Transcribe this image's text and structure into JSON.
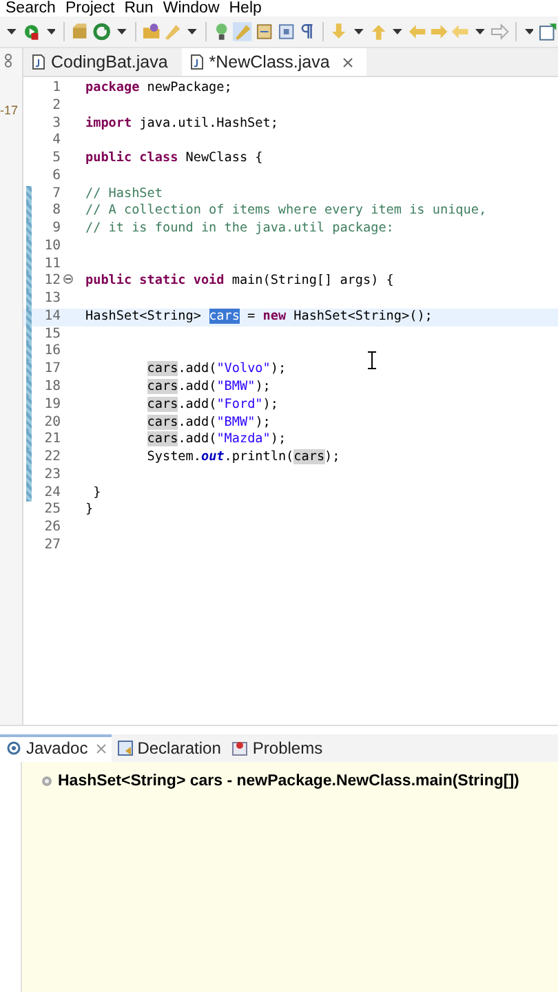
{
  "menu_bar": [
    "Search",
    "Project",
    "Run",
    "Window",
    "Help"
  ],
  "side_strip": {
    "text": "-17"
  },
  "editor_tabs": [
    {
      "label": "CodingBat.java",
      "selected": false,
      "closable": false
    },
    {
      "label": "*NewClass.java",
      "selected": true,
      "closable": true
    }
  ],
  "code_lines": [
    {
      "number": "1",
      "changed": false,
      "current": false,
      "tokens": [
        {
          "kind": "keyword",
          "text": "package"
        },
        {
          "kind": "text",
          "text": " newPackage;"
        }
      ]
    },
    {
      "number": "2",
      "changed": false,
      "current": false
    },
    {
      "number": "3",
      "changed": false,
      "current": false,
      "tokens": [
        {
          "kind": "keyword",
          "text": "import"
        },
        {
          "kind": "text",
          "text": " java.util.HashSet;"
        }
      ]
    },
    {
      "number": "4",
      "changed": false,
      "current": false
    },
    {
      "number": "5",
      "changed": false,
      "current": false,
      "tokens": [
        {
          "kind": "keyword",
          "text": "public class"
        },
        {
          "kind": "text",
          "text": " NewClass {"
        }
      ]
    },
    {
      "number": "6",
      "changed": false,
      "current": false
    },
    {
      "number": "7",
      "changed": true,
      "current": false,
      "tokens": [
        {
          "kind": "comment",
          "text": "// HashSet"
        }
      ]
    },
    {
      "number": "8",
      "changed": true,
      "current": false,
      "tokens": [
        {
          "kind": "comment",
          "text": "// A collection of items where every item is unique,"
        }
      ]
    },
    {
      "number": "9",
      "changed": true,
      "current": false,
      "tokens": [
        {
          "kind": "comment",
          "text": "// it is found in the java.util package:"
        }
      ]
    },
    {
      "number": "10",
      "changed": true,
      "current": false
    },
    {
      "number": "11",
      "changed": true,
      "current": false
    },
    {
      "number": "12",
      "changed": true,
      "current": false,
      "folded": false,
      "tokens": [
        {
          "kind": "keyword",
          "text": "public static void"
        },
        {
          "kind": "text",
          "text": " main(String[] args) {"
        }
      ]
    },
    {
      "number": "13",
      "changed": true,
      "current": false
    },
    {
      "number": "14",
      "changed": true,
      "current": true,
      "tokens": [
        {
          "kind": "text",
          "text": "HashSet<String> "
        },
        {
          "kind": "selected",
          "text": "cars"
        },
        {
          "kind": "text",
          "text": " = "
        },
        {
          "kind": "keyword",
          "text": "new"
        },
        {
          "kind": "text",
          "text": " HashSet<String>();"
        }
      ]
    },
    {
      "number": "15",
      "changed": true,
      "current": false
    },
    {
      "number": "16",
      "changed": true,
      "current": false
    },
    {
      "number": "17",
      "changed": true,
      "current": false,
      "indented": true,
      "tokens": [
        {
          "kind": "occurrence",
          "text": "cars"
        },
        {
          "kind": "text",
          "text": ".add("
        },
        {
          "kind": "string",
          "text": "\"Volvo\""
        },
        {
          "kind": "text",
          "text": ");"
        }
      ]
    },
    {
      "number": "18",
      "changed": true,
      "current": false,
      "indented": true,
      "tokens": [
        {
          "kind": "occurrence",
          "text": "cars"
        },
        {
          "kind": "text",
          "text": ".add("
        },
        {
          "kind": "string",
          "text": "\"BMW\""
        },
        {
          "kind": "text",
          "text": ");"
        }
      ]
    },
    {
      "number": "19",
      "changed": true,
      "current": false,
      "indented": true,
      "tokens": [
        {
          "kind": "occurrence",
          "text": "cars"
        },
        {
          "kind": "text",
          "text": ".add("
        },
        {
          "kind": "string",
          "text": "\"Ford\""
        },
        {
          "kind": "text",
          "text": ");"
        }
      ]
    },
    {
      "number": "20",
      "changed": true,
      "current": false,
      "indented": true,
      "tokens": [
        {
          "kind": "occurrence",
          "text": "cars"
        },
        {
          "kind": "text",
          "text": ".add("
        },
        {
          "kind": "string",
          "text": "\"BMW\""
        },
        {
          "kind": "text",
          "text": ");"
        }
      ]
    },
    {
      "number": "21",
      "changed": true,
      "current": false,
      "indented": true,
      "tokens": [
        {
          "kind": "occurrence",
          "text": "cars"
        },
        {
          "kind": "text",
          "text": ".add("
        },
        {
          "kind": "string",
          "text": "\"Mazda\""
        },
        {
          "kind": "text",
          "text": ");"
        }
      ]
    },
    {
      "number": "22",
      "changed": true,
      "current": false,
      "indented": true,
      "tokens": [
        {
          "kind": "text",
          "text": "System."
        },
        {
          "kind": "field",
          "text": "out"
        },
        {
          "kind": "text",
          "text": ".println("
        },
        {
          "kind": "occurrence",
          "text": "cars"
        },
        {
          "kind": "text",
          "text": ");"
        }
      ]
    },
    {
      "number": "23",
      "changed": true,
      "current": false
    },
    {
      "number": "24",
      "changed": true,
      "current": false,
      "tokens": [
        {
          "kind": "text",
          "text": " }"
        }
      ]
    },
    {
      "number": "25",
      "changed": false,
      "current": false,
      "tokens": [
        {
          "kind": "text",
          "text": "}"
        }
      ]
    },
    {
      "number": "26",
      "changed": false,
      "current": false
    },
    {
      "number": "27",
      "changed": false,
      "current": false
    }
  ],
  "bottom_tabs": [
    {
      "label": "Javadoc",
      "kind": "javadoc",
      "selected": true,
      "closable": true
    },
    {
      "label": "Declaration",
      "kind": "declaration",
      "selected": false,
      "closable": false
    },
    {
      "label": "Problems",
      "kind": "problems",
      "selected": false,
      "closable": false
    }
  ],
  "javadoc": {
    "signature": "HashSet<String> cars - newPackage.NewClass.main(String[])"
  }
}
